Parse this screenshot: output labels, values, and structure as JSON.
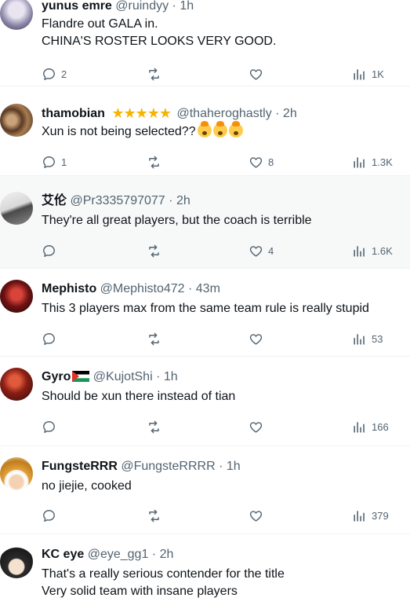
{
  "tweets": [
    {
      "name": "yunus emre",
      "handle": "@ruindyy",
      "time": "1h",
      "lines": [
        "Flandre out GALA in.",
        "CHINA'S ROSTER LOOKS VERY GOOD."
      ],
      "replies": "2",
      "retweets": "",
      "likes": "",
      "views": "1K",
      "avatar_icon": "cartoon-girl-avatar"
    },
    {
      "name": "thamobian",
      "stars": "★★★★★",
      "handle": "@thaheroghastly",
      "time": "2h",
      "lines": [
        "Xun is not being selected??"
      ],
      "emoji_count": 3,
      "replies": "1",
      "retweets": "",
      "likes": "8",
      "views": "1.3K",
      "avatar_icon": "group-photo-avatar"
    },
    {
      "name": "艾伦",
      "handle": "@Pr3335797077",
      "time": "2h",
      "lines": [
        "They're all great players, but the coach is terrible"
      ],
      "replies": "",
      "retweets": "",
      "likes": "4",
      "views": "1.6K",
      "avatar_icon": "sketch-figure-avatar"
    },
    {
      "name": "Mephisto",
      "handle": "@Mephisto472",
      "time": "43m",
      "lines": [
        "This 3 players max from the same team rule is really stupid"
      ],
      "replies": "",
      "retweets": "",
      "likes": "",
      "views": "53",
      "avatar_icon": "red-demon-avatar"
    },
    {
      "name": "Gyro",
      "handle": "@KujotShi",
      "time": "1h",
      "lines": [
        "Should be xun there instead of tian"
      ],
      "replies": "",
      "retweets": "",
      "likes": "",
      "views": "166",
      "avatar_icon": "red-character-avatar"
    },
    {
      "name": "FungsteRRR",
      "handle": "@FungsteRRRR",
      "time": "1h",
      "lines": [
        "no jiejie, cooked"
      ],
      "replies": "",
      "retweets": "",
      "likes": "",
      "views": "379",
      "avatar_icon": "straw-hat-avatar"
    },
    {
      "name": "KC eye",
      "handle": "@eye_gg1",
      "time": "2h",
      "lines": [
        "That's a really serious contender for the title",
        "Very solid team with insane players"
      ],
      "replies": "",
      "retweets": "",
      "likes": "",
      "views": "",
      "avatar_icon": "anime-boy-avatar"
    }
  ],
  "separator": "·",
  "colors": {
    "text": "#0f1419",
    "muted": "#536471",
    "border": "#eff3f4",
    "highlight_bg": "#f7f9f9",
    "star": "#f5b400"
  }
}
